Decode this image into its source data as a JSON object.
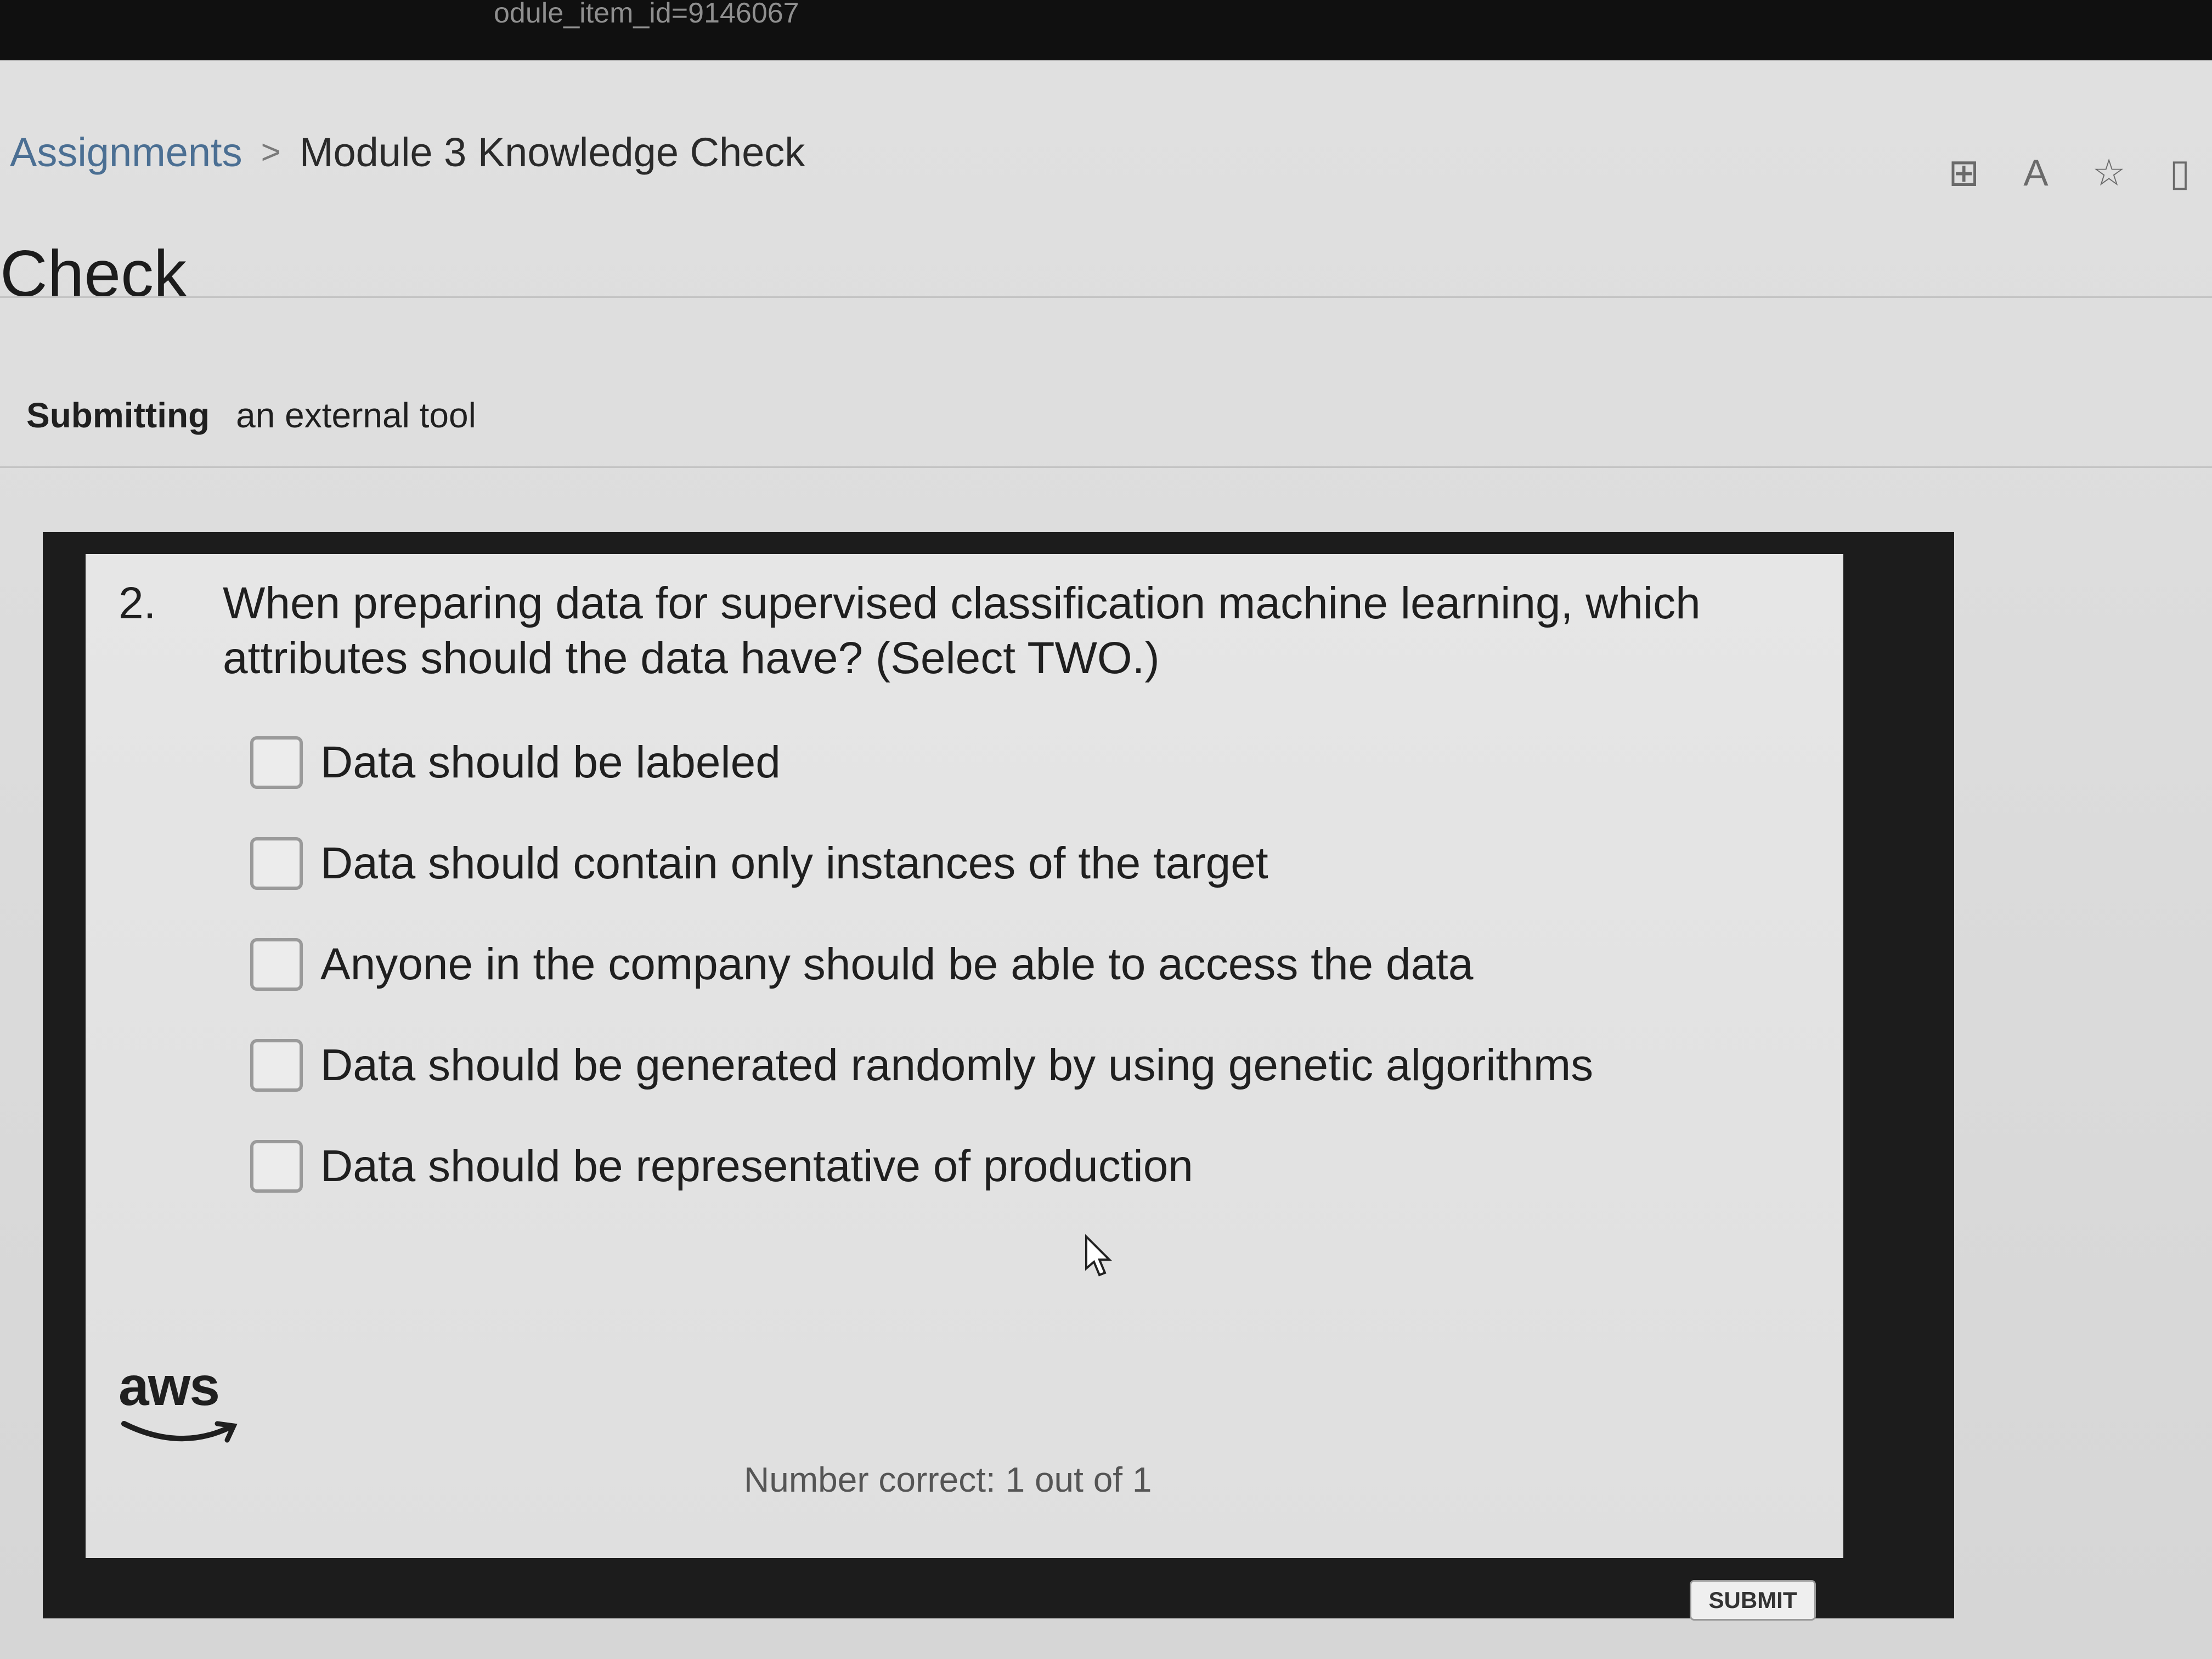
{
  "browser": {
    "url_fragment": "odule_item_id=9146067",
    "icons": [
      "split-screen-icon",
      "read-aloud-icon",
      "favorite-star-icon",
      "sidebar-icon"
    ]
  },
  "breadcrumb": {
    "parent": "Assignments",
    "separator": ">",
    "current": "Module 3 Knowledge Check"
  },
  "page": {
    "title": "Check",
    "submitting_label": "Submitting",
    "submitting_value": "an external tool"
  },
  "quiz": {
    "question_number": "2.",
    "question_text": "When preparing data for supervised classification machine learning, which attributes should the data have? (Select TWO.)",
    "options": [
      {
        "label": "Data should be labeled",
        "checked": false
      },
      {
        "label": "Data should contain only instances of the target",
        "checked": false
      },
      {
        "label": "Anyone in the company should be able to access the data",
        "checked": false
      },
      {
        "label": "Data should be generated randomly by using genetic algorithms",
        "checked": false
      },
      {
        "label": "Data should be representative of production",
        "checked": false
      }
    ],
    "logo_text": "aws",
    "score_text": "Number correct: 1 out of 1",
    "submit_label": "SUBMIT"
  },
  "colors": {
    "link": "#4b6f93",
    "frame": "#1c1c1c",
    "background": "#d9d9d9"
  }
}
